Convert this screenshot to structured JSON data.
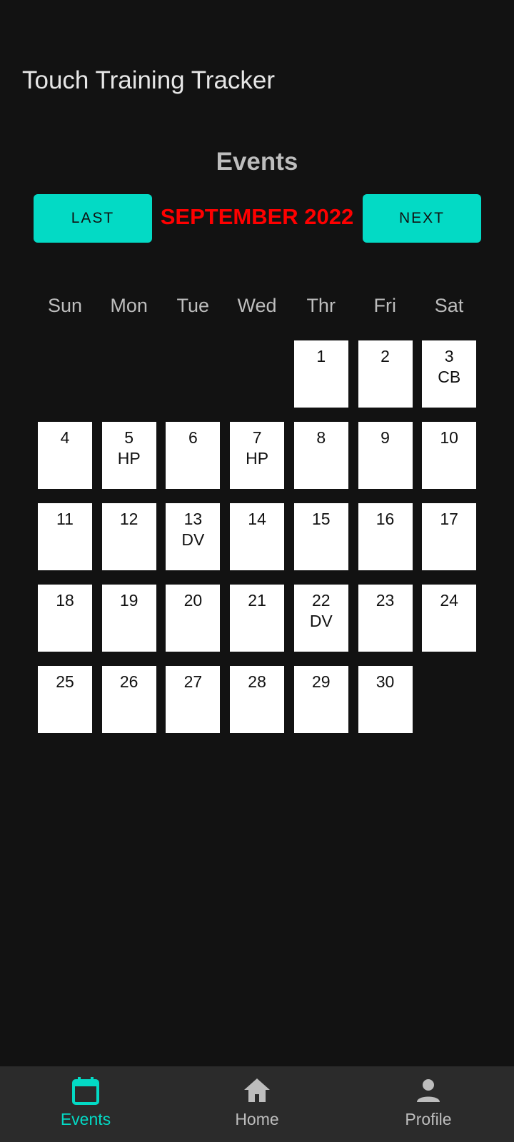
{
  "app": {
    "title": "Touch Training Tracker"
  },
  "page": {
    "title": "Events"
  },
  "month_nav": {
    "prev_label": "LAST",
    "next_label": "NEXT",
    "month_label": "SEPTEMBER 2022"
  },
  "calendar": {
    "weekdays": [
      "Sun",
      "Mon",
      "Tue",
      "Wed",
      "Thr",
      "Fri",
      "Sat"
    ],
    "leading_blank_days": 4,
    "days": [
      {
        "day": "1",
        "event": ""
      },
      {
        "day": "2",
        "event": ""
      },
      {
        "day": "3",
        "event": "CB"
      },
      {
        "day": "4",
        "event": ""
      },
      {
        "day": "5",
        "event": "HP"
      },
      {
        "day": "6",
        "event": ""
      },
      {
        "day": "7",
        "event": "HP"
      },
      {
        "day": "8",
        "event": ""
      },
      {
        "day": "9",
        "event": ""
      },
      {
        "day": "10",
        "event": ""
      },
      {
        "day": "11",
        "event": ""
      },
      {
        "day": "12",
        "event": ""
      },
      {
        "day": "13",
        "event": "DV"
      },
      {
        "day": "14",
        "event": ""
      },
      {
        "day": "15",
        "event": ""
      },
      {
        "day": "16",
        "event": ""
      },
      {
        "day": "17",
        "event": ""
      },
      {
        "day": "18",
        "event": ""
      },
      {
        "day": "19",
        "event": ""
      },
      {
        "day": "20",
        "event": ""
      },
      {
        "day": "21",
        "event": ""
      },
      {
        "day": "22",
        "event": "DV"
      },
      {
        "day": "23",
        "event": ""
      },
      {
        "day": "24",
        "event": ""
      },
      {
        "day": "25",
        "event": ""
      },
      {
        "day": "26",
        "event": ""
      },
      {
        "day": "27",
        "event": ""
      },
      {
        "day": "28",
        "event": ""
      },
      {
        "day": "29",
        "event": ""
      },
      {
        "day": "30",
        "event": ""
      }
    ]
  },
  "bottom_nav": {
    "items": [
      {
        "label": "Events",
        "icon": "calendar-icon",
        "active": true
      },
      {
        "label": "Home",
        "icon": "home-icon",
        "active": false
      },
      {
        "label": "Profile",
        "icon": "person-icon",
        "active": false
      }
    ]
  },
  "colors": {
    "background": "#121212",
    "accent": "#03dac5",
    "month_label": "#ff0000",
    "nav_bar": "#2b2b2b",
    "day_cell": "#ffffff"
  }
}
